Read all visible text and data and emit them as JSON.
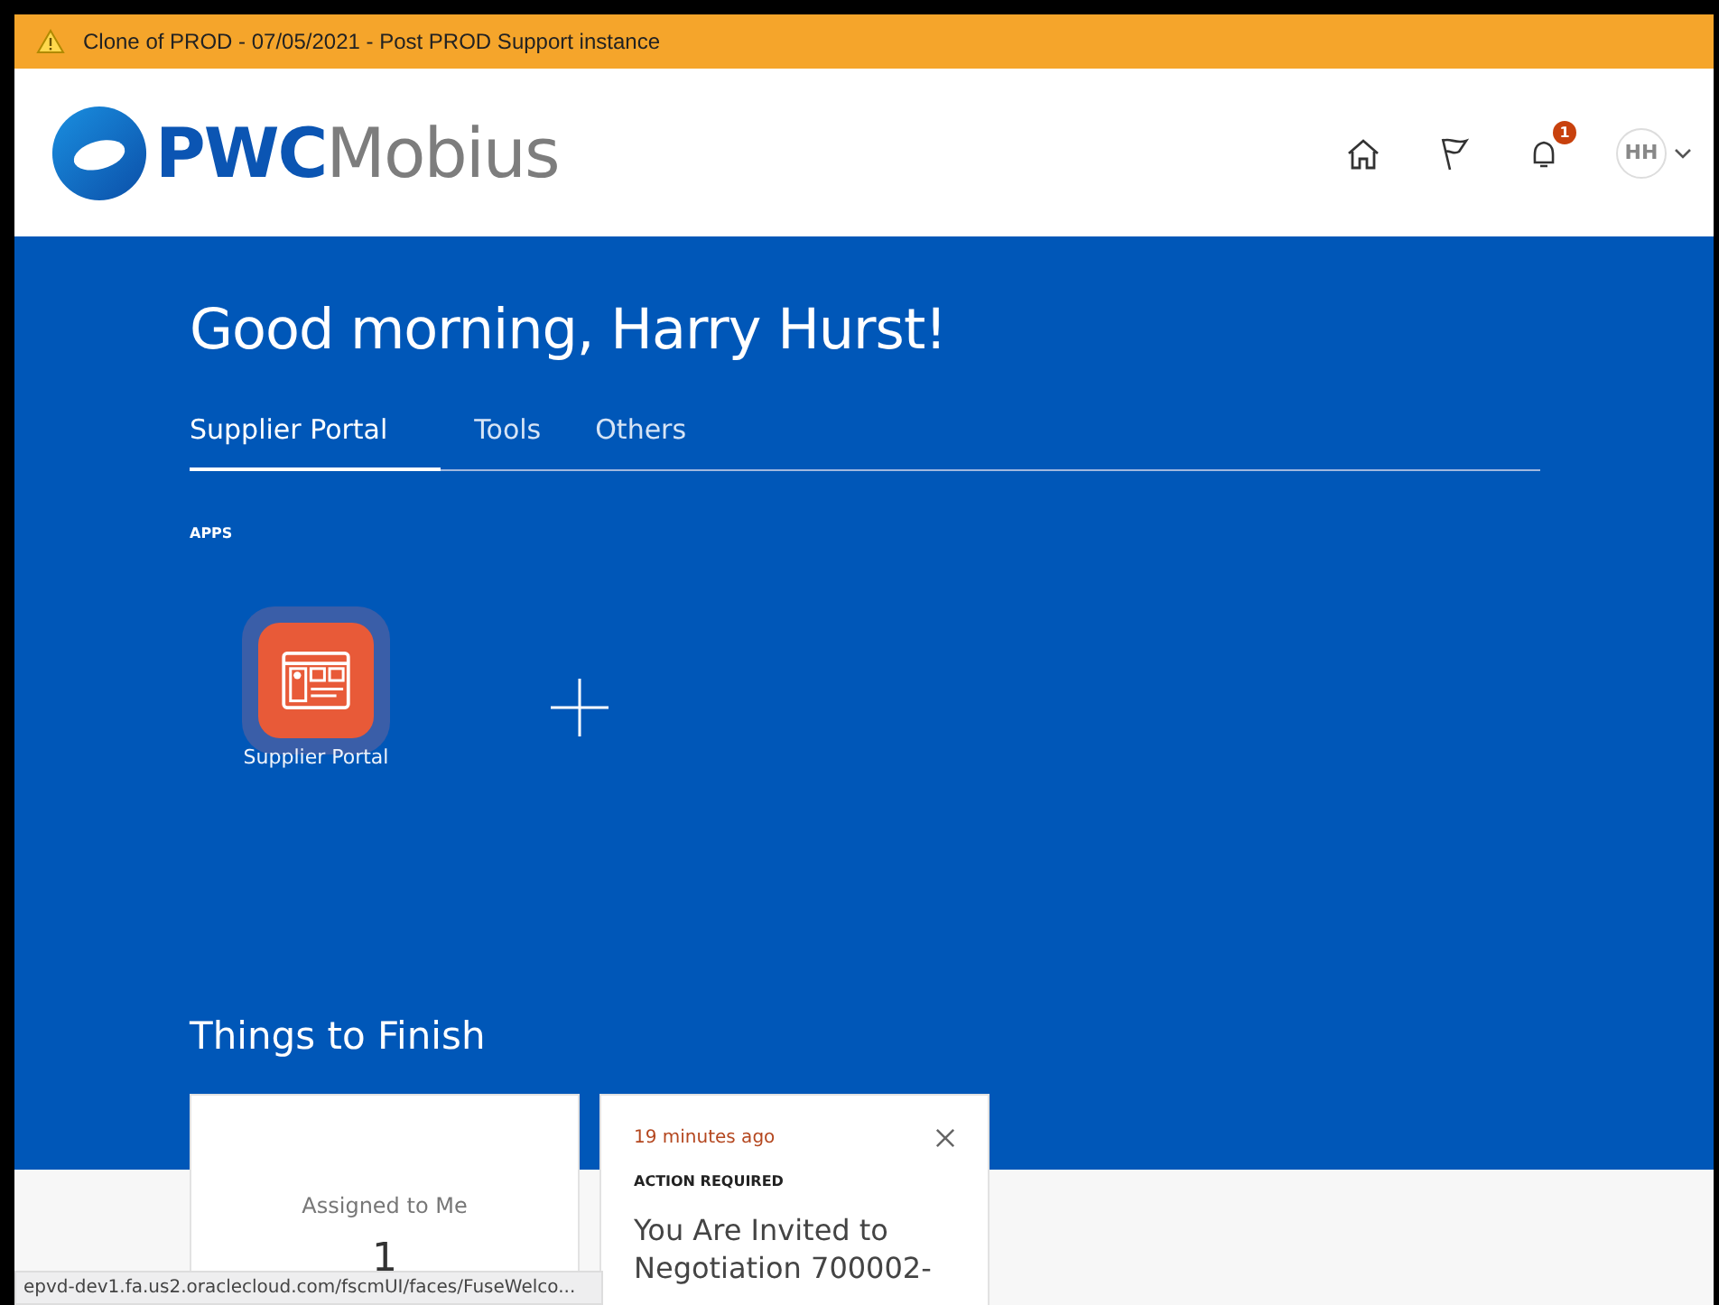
{
  "banner": {
    "text": "Clone of PROD - 07/05/2021 - Post PROD Support instance"
  },
  "header": {
    "logo_bold": "PWC",
    "logo_light": "Mobius",
    "notification_count": "1",
    "avatar": "HH"
  },
  "greeting": "Good morning, Harry Hurst!",
  "tabs": [
    {
      "label": "Supplier Portal",
      "selected": true
    },
    {
      "label": "Tools",
      "selected": false
    },
    {
      "label": "Others",
      "selected": false
    }
  ],
  "apps_heading": "APPS",
  "apps": [
    {
      "label": "Supplier Portal"
    }
  ],
  "things_heading": "Things to Finish",
  "cards": [
    {
      "kind": "count",
      "title": "Assigned to Me",
      "count": "1"
    },
    {
      "kind": "notice",
      "time": "19 minutes ago",
      "tag": "ACTION REQUIRED",
      "message": "You Are Invited to Negotiation 700002-"
    }
  ],
  "status_url": "epvd-dev1.fa.us2.oraclecloud.com/fscmUI/faces/FuseWelco..."
}
